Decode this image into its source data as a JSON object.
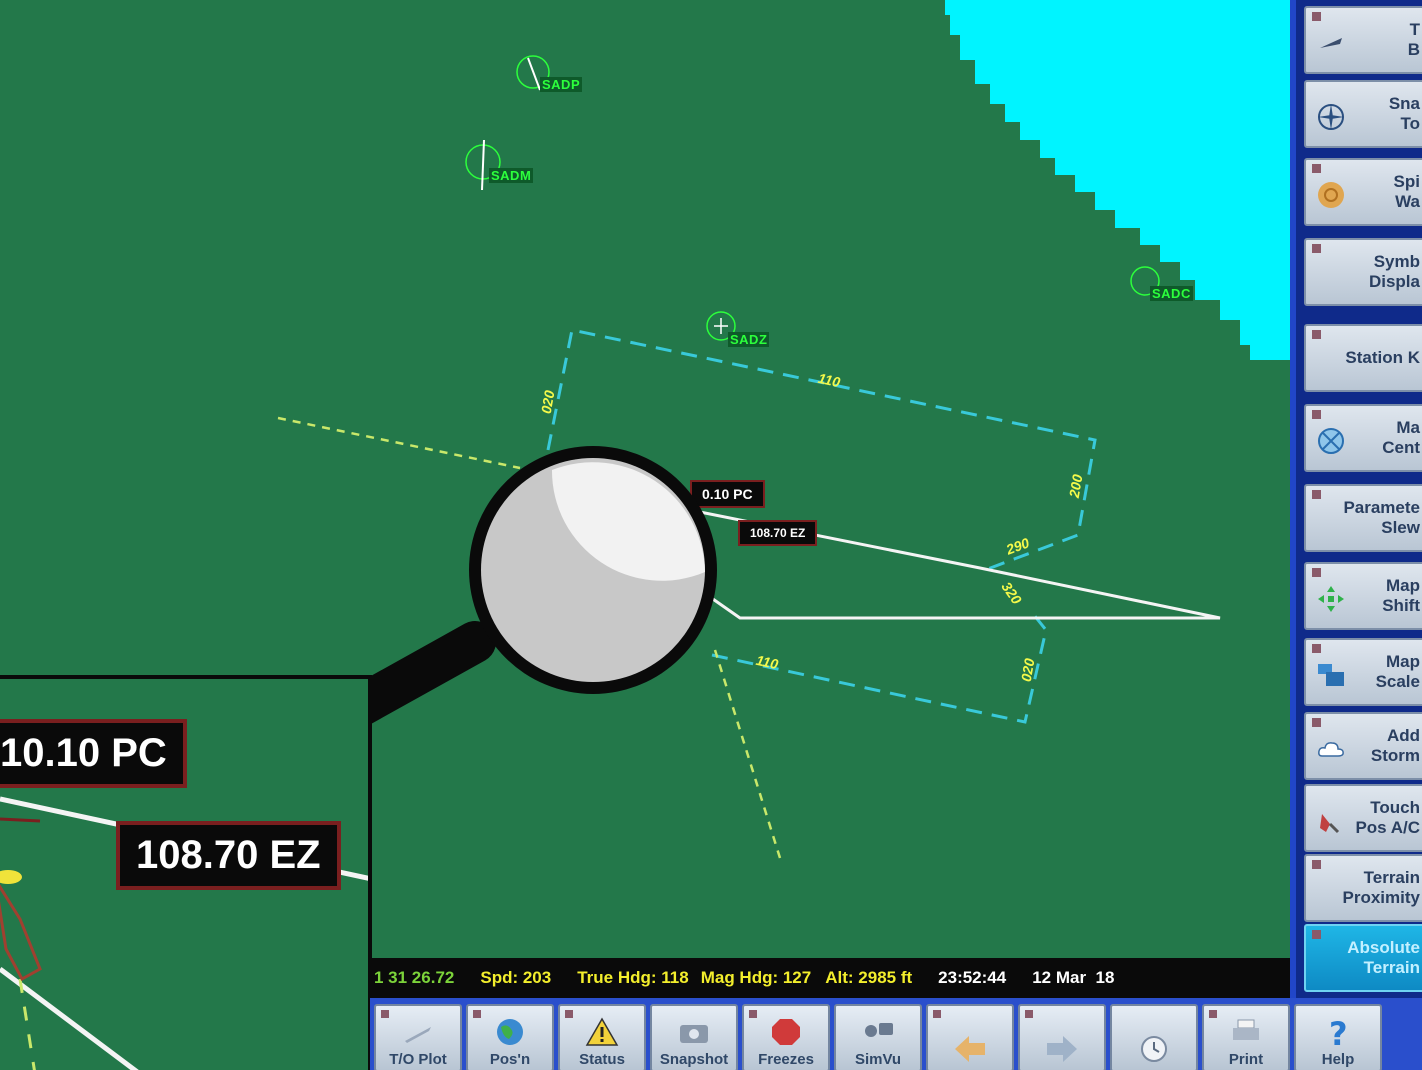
{
  "map": {
    "waypoints": [
      {
        "id": "SADP"
      },
      {
        "id": "SADM"
      },
      {
        "id": "SADZ"
      },
      {
        "id": "SADC"
      }
    ],
    "radials": [
      "020",
      "110",
      "200",
      "290",
      "320",
      "110",
      "020"
    ],
    "freq_boxes": [
      {
        "label": "0.10 PC"
      },
      {
        "label": "108.70 EZ"
      }
    ],
    "colors": {
      "terrain": "#23784a",
      "water": "#00f4ff",
      "route": "#39c9d9",
      "track": "#c9e86a"
    }
  },
  "side_panel": {
    "buttons": [
      {
        "label": "T\nB",
        "icon": "plane-icon"
      },
      {
        "label": "Sna\nTo",
        "icon": "compass-icon"
      },
      {
        "label": "Spi\nWa",
        "icon": "spiral-icon"
      },
      {
        "label": "Symb\nDispla",
        "icon": "none"
      },
      {
        "label": "Station K",
        "icon": "none"
      },
      {
        "label": "Ma\nCent",
        "icon": "map-center-icon"
      },
      {
        "label": "Paramete\nSlew",
        "icon": "none"
      },
      {
        "label": "Map\nShift",
        "icon": "move-arrows-icon"
      },
      {
        "label": "Map\nScale",
        "icon": "scale-icon"
      },
      {
        "label": "Add\nStorm",
        "icon": "cloud-icon"
      },
      {
        "label": "Touch\nPos A/C",
        "icon": "hand-icon"
      },
      {
        "label": "Terrain\nProximity",
        "icon": "none"
      },
      {
        "label": "Absolute\nTerrain",
        "icon": "none",
        "active": true
      }
    ]
  },
  "status_bar": {
    "coord": "1 31 26.72",
    "speed": "Spd: 203",
    "true_hdg": "True Hdg: 118",
    "mag_hdg": "Mag Hdg: 127",
    "alt": "Alt: 2985 ft",
    "time": "23:52:44",
    "date": "12 Mar  18"
  },
  "toolbar": {
    "buttons": [
      {
        "label": "T/O Plot",
        "icon": "runway-icon"
      },
      {
        "label": "Pos'n",
        "icon": "globe-icon"
      },
      {
        "label": "Status",
        "icon": "warning-icon"
      },
      {
        "label": "Snapshot",
        "icon": "camera-icon"
      },
      {
        "label": "Freezes",
        "icon": "stop-icon"
      },
      {
        "label": "SimVu",
        "icon": "simvu-icon"
      },
      {
        "label": "",
        "icon": "back-arrow-icon"
      },
      {
        "label": "",
        "icon": "forward-arrow-icon"
      },
      {
        "label": "",
        "icon": "clock-icon"
      },
      {
        "label": "Print",
        "icon": "printer-icon"
      },
      {
        "label": "Help",
        "icon": "help-icon"
      }
    ]
  },
  "zoom_inset": {
    "labels": [
      "10.10 PC",
      "108.70 EZ"
    ]
  }
}
